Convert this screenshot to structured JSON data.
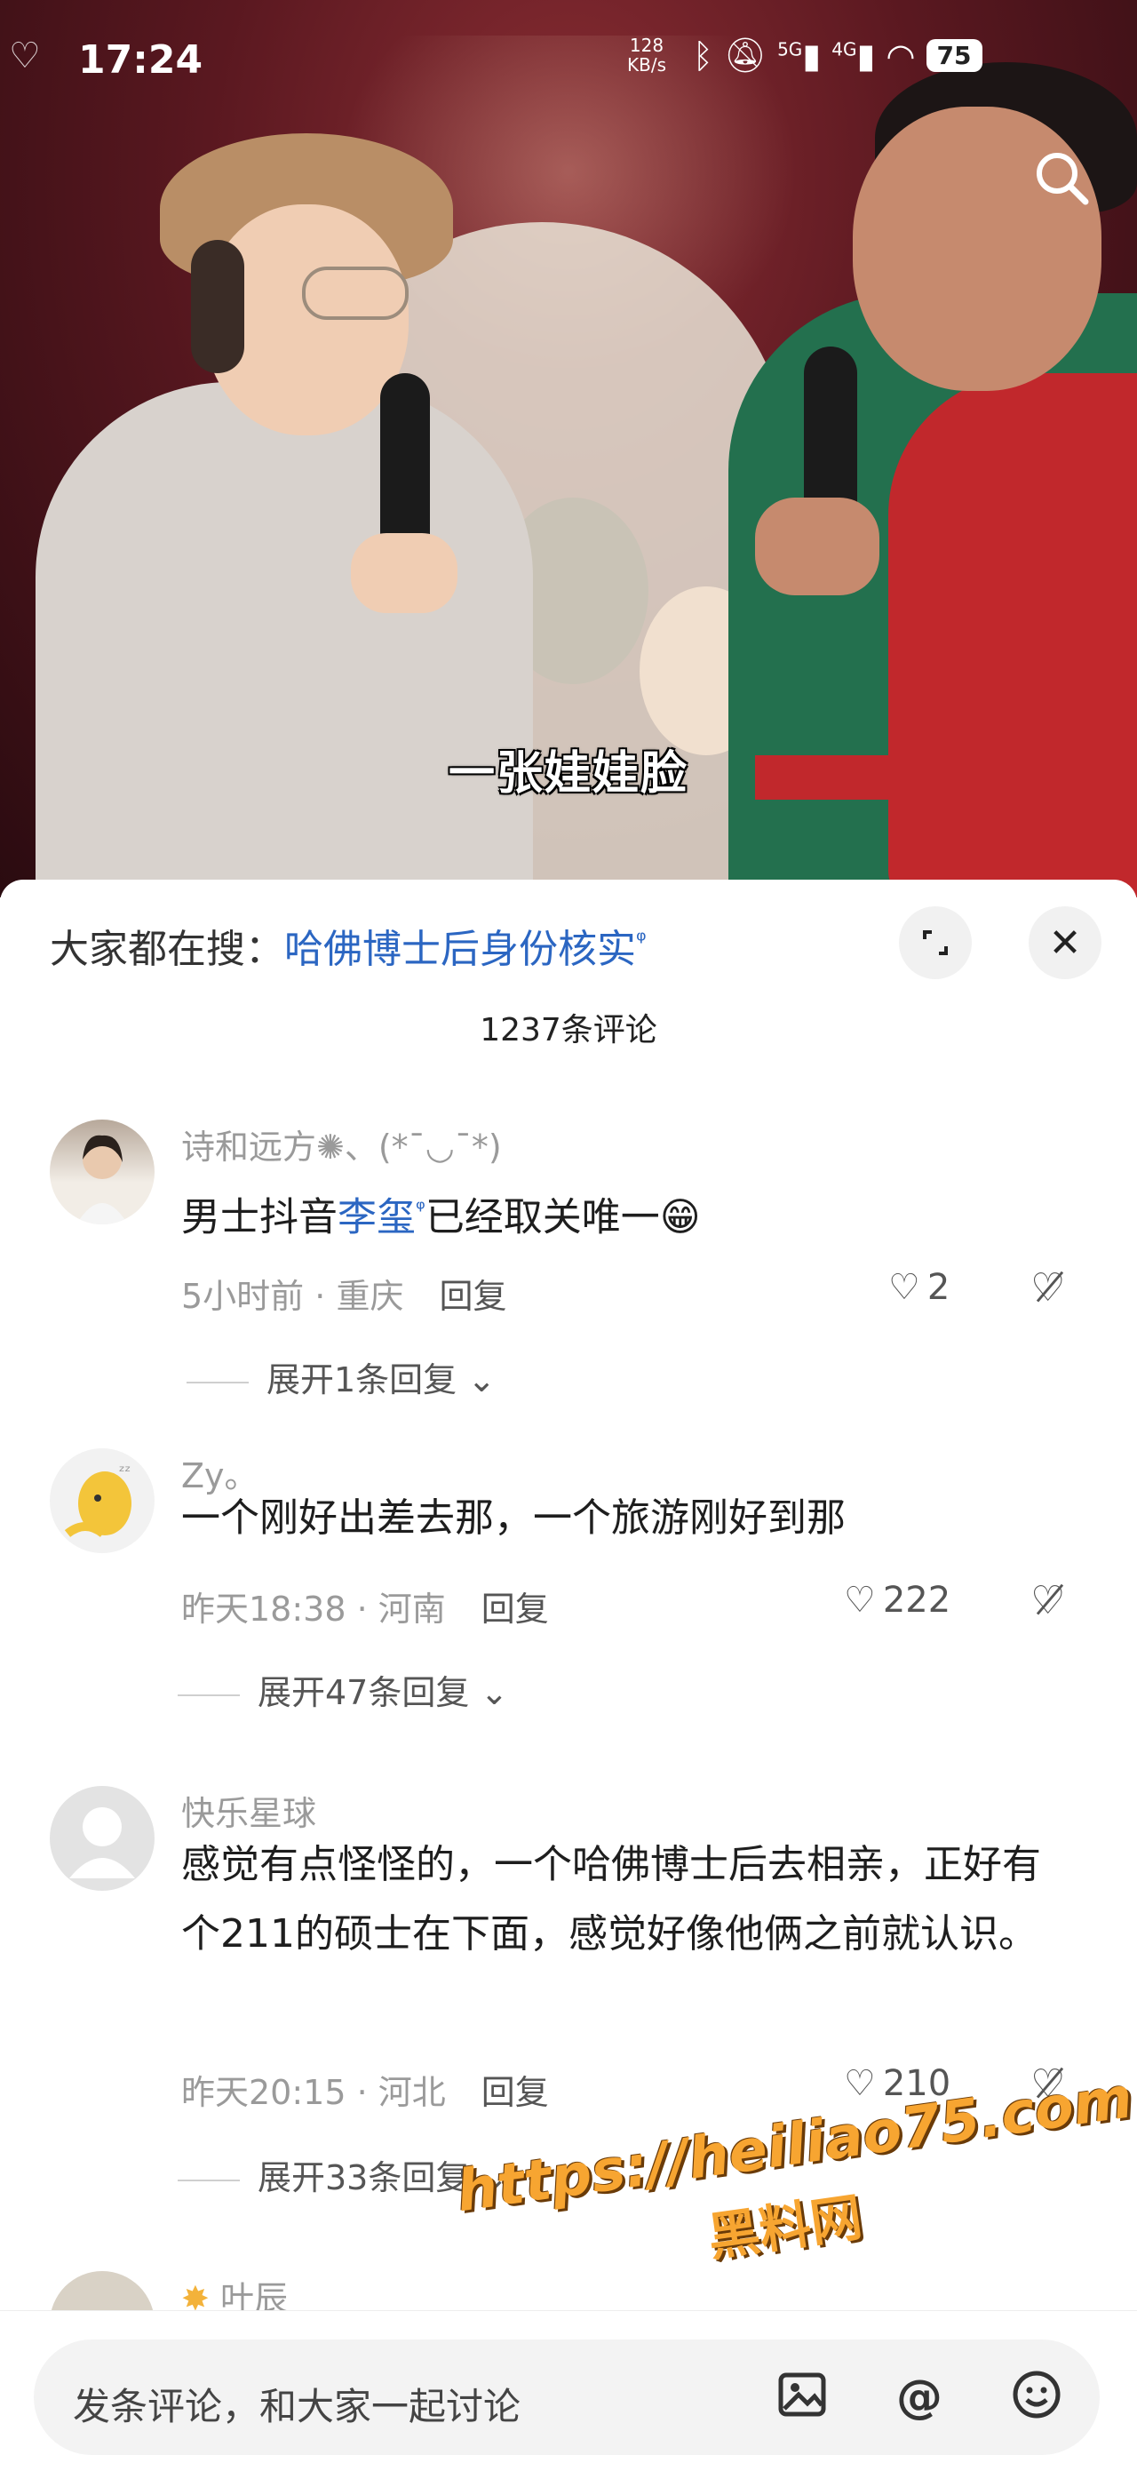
{
  "status_bar": {
    "time": "17:24",
    "net_speed": "128",
    "net_unit": "KB/s",
    "signal_1": "5G",
    "signal_2": "4G",
    "battery": "75"
  },
  "video": {
    "subtitle": "一张娃娃脸"
  },
  "sheet": {
    "search_prefix": "大家都在搜：",
    "search_term": "哈佛博士后身份核实",
    "comment_count": "1237条评论"
  },
  "comments": [
    {
      "name": "诗和远方",
      "name_suffix": "✺、(*¯◡¯*)",
      "text_before": "男士抖音",
      "mention": "李玺",
      "text_after": "已经取关唯一😁",
      "time": "5小时前",
      "location": "重庆",
      "reply": "回复",
      "likes": "2",
      "expand": "展开1条回复"
    },
    {
      "name": "Zy。",
      "text": "一个刚好出差去那，一个旅游刚好到那",
      "time": "昨天18:38",
      "location": "河南",
      "reply": "回复",
      "likes": "222",
      "expand": "展开47条回复"
    },
    {
      "name": "快乐星球",
      "text": "感觉有点怪怪的，一个哈佛博士后去相亲，正好有个211的硕士在下面，感觉好像他俩之前就认识。",
      "time": "昨天20:15",
      "location": "河北",
      "reply": "回复",
      "likes": "210",
      "expand": "展开33条回复"
    },
    {
      "name": "叶辰"
    }
  ],
  "input": {
    "placeholder": "发条评论，和大家一起讨论"
  },
  "watermark": {
    "url": "https://heiliao75.com",
    "cn": "黑料网"
  },
  "icons": [
    "search-icon",
    "expand-icon",
    "close-icon",
    "heart-icon",
    "dislike-icon",
    "image-icon",
    "at-icon",
    "emoji-icon"
  ]
}
